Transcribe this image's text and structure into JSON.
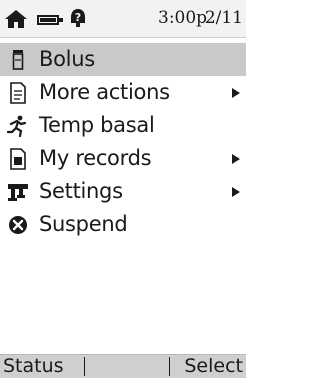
{
  "status_bar": {
    "icons": [
      "home-icon",
      "battery-icon",
      "alert-icon"
    ],
    "time": "3:00p",
    "date": "2/11"
  },
  "menu": {
    "items": [
      {
        "label": "Bolus",
        "icon": "insulin-vial-icon",
        "selected": true,
        "has_submenu": false
      },
      {
        "label": "More actions",
        "icon": "document-icon",
        "selected": false,
        "has_submenu": true
      },
      {
        "label": "Temp basal",
        "icon": "runner-icon",
        "selected": false,
        "has_submenu": false
      },
      {
        "label": "My records",
        "icon": "records-icon",
        "selected": false,
        "has_submenu": true
      },
      {
        "label": "Settings",
        "icon": "settings-icon",
        "selected": false,
        "has_submenu": true
      },
      {
        "label": "Suspend",
        "icon": "suspend-icon",
        "selected": false,
        "has_submenu": false
      }
    ]
  },
  "softkeys": {
    "left": "Status",
    "right": "Select"
  },
  "colors": {
    "selected_row": "#c9c9c9",
    "softkey_bar": "#cfcfcf",
    "status_bar": "#f2f2f2",
    "text": "#1a1a1a"
  }
}
